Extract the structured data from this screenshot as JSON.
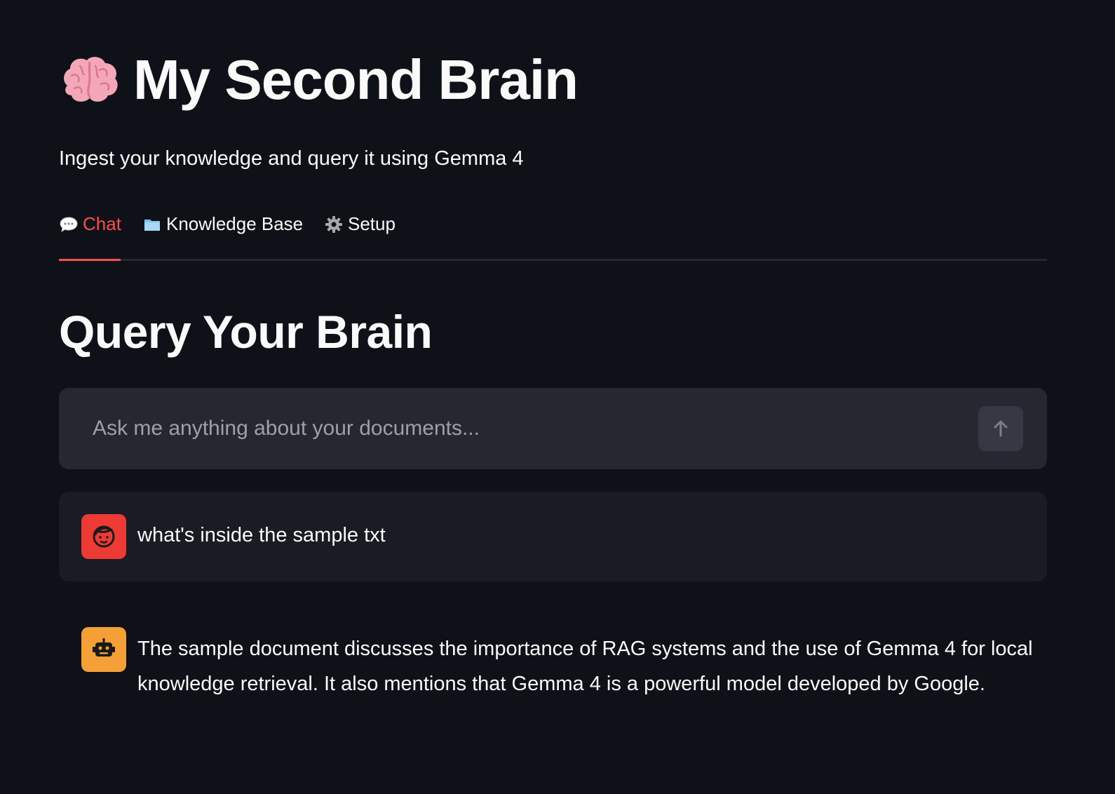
{
  "header": {
    "icon": "brain-emoji-icon",
    "title": "My Second Brain",
    "subtitle": "Ingest your knowledge and query it using Gemma 4"
  },
  "tabs": [
    {
      "icon": "speech-bubble-icon",
      "label": "Chat",
      "active": true
    },
    {
      "icon": "folder-icon",
      "label": "Knowledge Base",
      "active": false
    },
    {
      "icon": "gear-icon",
      "label": "Setup",
      "active": false
    }
  ],
  "main": {
    "section_title": "Query Your Brain",
    "chat_input": {
      "placeholder": "Ask me anything about your documents...",
      "value": "",
      "send_icon": "arrow-up-icon"
    },
    "messages": [
      {
        "role": "user",
        "avatar_icon": "user-face-icon",
        "text": "what's inside the sample txt"
      },
      {
        "role": "assistant",
        "avatar_icon": "robot-icon",
        "text": "The sample document discusses the importance of RAG systems and the use of Gemma 4 for local knowledge retrieval. It also mentions that Gemma 4 is a powerful model developed by Google."
      }
    ]
  },
  "colors": {
    "background": "#0e1117",
    "accent": "#ff4b4b",
    "input_bg": "#262730",
    "user_message_bg": "#1a1c24",
    "user_avatar": "#ee3a34",
    "assistant_avatar": "#f59f37"
  }
}
